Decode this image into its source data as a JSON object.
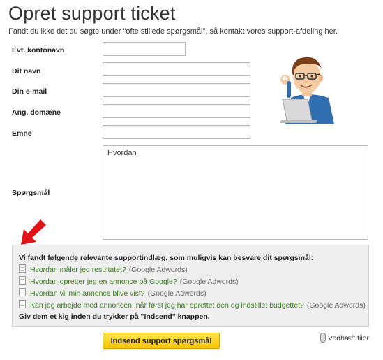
{
  "page": {
    "title": "Opret support ticket",
    "intro": "Fandt du ikke det du søgte under \"ofte stillede spørgsmål\", så kontakt vores support-afdeling her."
  },
  "form": {
    "labels": {
      "account": "Evt. kontonavn",
      "name": "Dit navn",
      "email": "Din e-mail",
      "domain": "Ang. domæne",
      "subject": "Emne",
      "question": "Spørgsmål"
    },
    "values": {
      "account": "",
      "name": "",
      "email": "",
      "domain": "",
      "subject": "",
      "question": "Hvordan"
    }
  },
  "suggestions": {
    "heading": "Vi fandt følgende relevante supportindlæg, som muligvis kan besvare dit spørgsmål:",
    "items": [
      {
        "title": "Hvordan måler jeg resultatet?",
        "category": "(Google Adwords)"
      },
      {
        "title": "Hvordan opretter jeg en annonce på Google?",
        "category": "(Google Adwords)"
      },
      {
        "title": "Hvordan vil min annonce blive vist?",
        "category": "(Google Adwords)"
      },
      {
        "title": "Kan jeg arbejde med annoncen, når først jeg har oprettet den og indstillet budgettet?",
        "category": "(Google Adwords)"
      }
    ],
    "footer": "Giv dem et kig inden du trykker på \"Indsend\" knappen."
  },
  "actions": {
    "submit_label": "Indsend support spørgsmål",
    "attach_label": "Vedhæft filer"
  },
  "colors": {
    "link": "#3a7a22",
    "button": "#f5c400",
    "arrow": "#e0121a"
  },
  "icons": {
    "suggestion": "document-icon",
    "attach": "paperclip-icon",
    "pointer": "red-arrow-icon",
    "mascot": "support-person-illustration"
  }
}
